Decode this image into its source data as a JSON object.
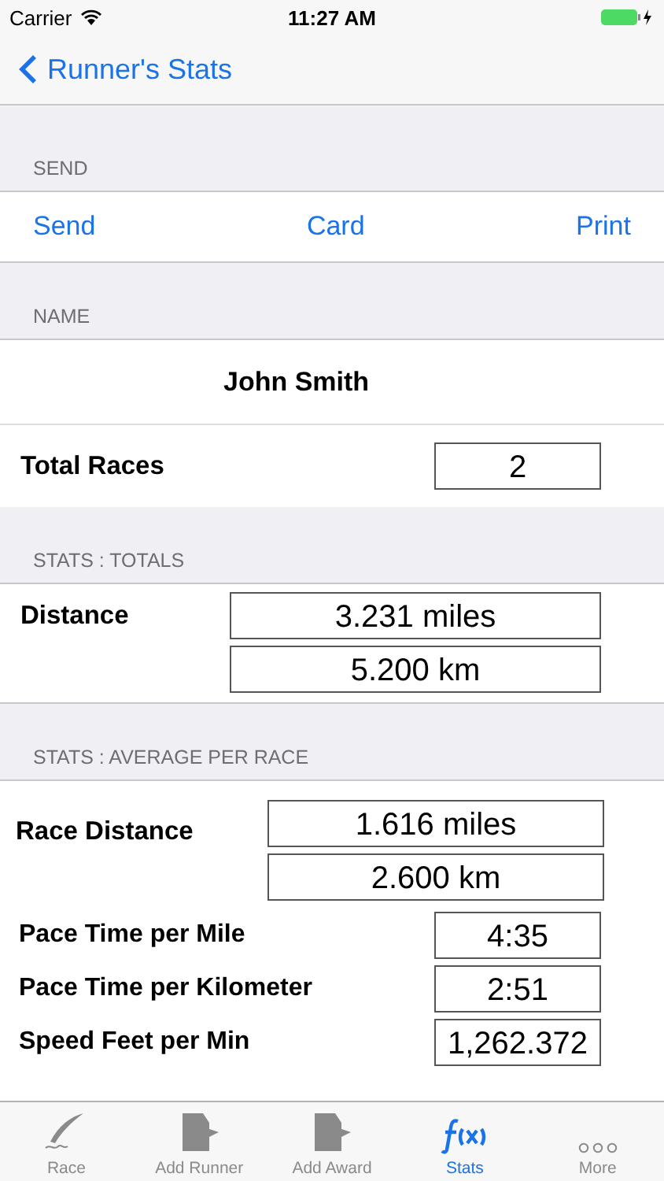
{
  "status_bar": {
    "carrier": "Carrier",
    "time": "11:27 AM"
  },
  "nav": {
    "back": "Runner's Stats"
  },
  "send_section": {
    "header": "SEND",
    "actions": [
      "Send",
      "Card",
      "Print"
    ]
  },
  "name_section": {
    "header": "NAME",
    "name": "John Smith",
    "total_label": "Total Races",
    "total_value": "2"
  },
  "totals_section": {
    "header": "STATS : TOTALS",
    "label": "Distance",
    "values": [
      "3.231 miles",
      "5.200 km"
    ]
  },
  "average_section": {
    "header": "STATS : AVERAGE PER RACE",
    "label": "Race Distance",
    "values": [
      "1.616 miles",
      "2.600 km"
    ],
    "rows": [
      {
        "label": "Pace Time per Mile",
        "value": "4:35"
      },
      {
        "label": "Pace Time per Kilometer",
        "value": "2:51"
      },
      {
        "label": "Speed Feet per Min",
        "value": "1,262.372"
      }
    ]
  },
  "tab_bar": [
    {
      "label": "Race",
      "kind": "quill",
      "selected": false
    },
    {
      "label": "Add Runner",
      "kind": "doc",
      "selected": false
    },
    {
      "label": "Add Award",
      "kind": "doc",
      "selected": false
    },
    {
      "label": "Stats",
      "kind": "fx",
      "selected": true
    },
    {
      "label": "More",
      "kind": "dots",
      "selected": false
    }
  ]
}
